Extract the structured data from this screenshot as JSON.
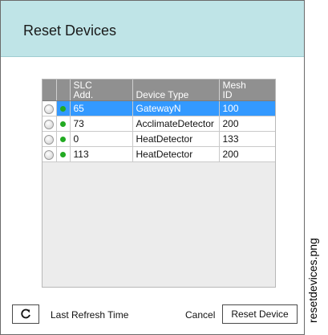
{
  "dialog": {
    "title": "Reset Devices"
  },
  "grid": {
    "columns": {
      "radio": "",
      "status": "",
      "slc_line1": "SLC",
      "slc_line2": "Add.",
      "device_type": "Device Type",
      "mesh_line1": "Mesh",
      "mesh_line2": "ID"
    },
    "rows": [
      {
        "slc": "65",
        "device_type": "GatewayN",
        "mesh_id": "100"
      },
      {
        "slc": "73",
        "device_type": "AcclimateDetector",
        "mesh_id": "200"
      },
      {
        "slc": "0",
        "device_type": "HeatDetector",
        "mesh_id": "133"
      },
      {
        "slc": "113",
        "device_type": "HeatDetector",
        "mesh_id": "200"
      }
    ],
    "selected_row": 0,
    "status_color": "#22aa22",
    "selection_color": "#3399ff"
  },
  "footer": {
    "refresh_icon": "refresh-icon",
    "refresh_glyph": "C",
    "last_refresh_label": "Last Refresh Time",
    "cancel_label": "Cancel",
    "reset_label": "Reset Device"
  },
  "caption": "resetdevices.png"
}
